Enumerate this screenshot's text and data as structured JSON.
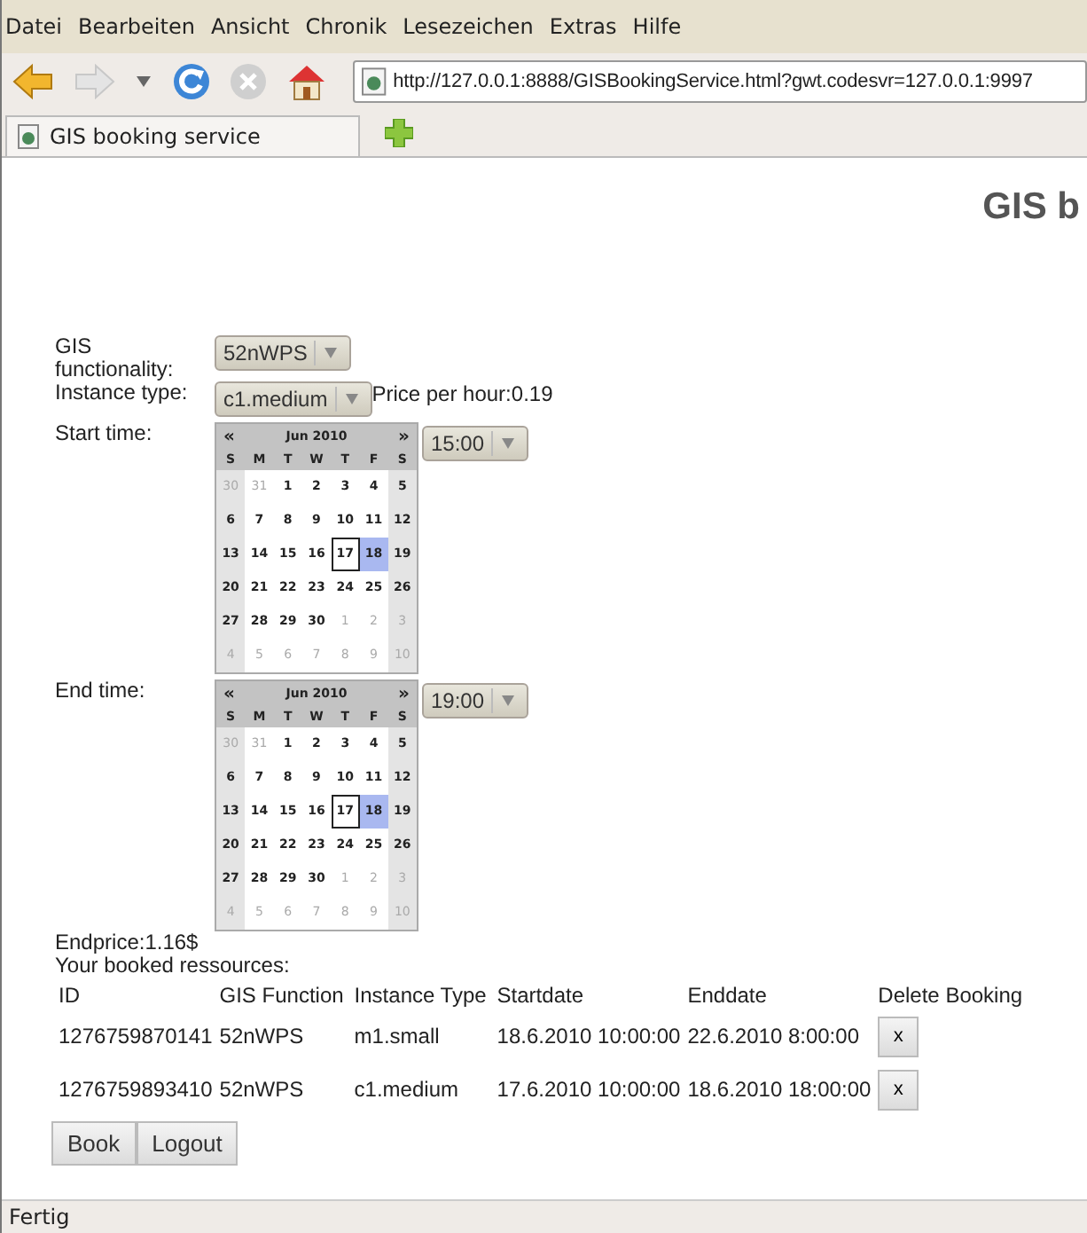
{
  "menu": [
    "Datei",
    "Bearbeiten",
    "Ansicht",
    "Chronik",
    "Lesezeichen",
    "Extras",
    "Hilfe"
  ],
  "address": {
    "value": "http://127.0.0.1:8888/GISBookingService.html?gwt.codesvr=127.0.0.1:9997"
  },
  "tab": {
    "title": "GIS booking service"
  },
  "heading": "GIS b",
  "form": {
    "gis_label": "GIS functionality:",
    "gis_value": "52nWPS",
    "instance_label": "Instance type:",
    "instance_value": "c1.medium",
    "price": "Price per hour:0.19",
    "pickers": [
      {
        "label": "Start time:",
        "time": "15:00",
        "calendar": {
          "prev": "«",
          "month": "Jun 2010",
          "next": "»",
          "weekdays": [
            "S",
            "M",
            "T",
            "W",
            "T",
            "F",
            "S"
          ],
          "weeks": [
            [
              {
                "d": "30",
                "other": true,
                "today": false,
                "selected": false
              },
              {
                "d": "31",
                "other": true,
                "today": false,
                "selected": false
              },
              {
                "d": "1",
                "other": false,
                "today": false,
                "selected": false
              },
              {
                "d": "2",
                "other": false,
                "today": false,
                "selected": false
              },
              {
                "d": "3",
                "other": false,
                "today": false,
                "selected": false
              },
              {
                "d": "4",
                "other": false,
                "today": false,
                "selected": false
              },
              {
                "d": "5",
                "other": false,
                "today": false,
                "selected": false
              }
            ],
            [
              {
                "d": "6",
                "other": false,
                "today": false,
                "selected": false
              },
              {
                "d": "7",
                "other": false,
                "today": false,
                "selected": false
              },
              {
                "d": "8",
                "other": false,
                "today": false,
                "selected": false
              },
              {
                "d": "9",
                "other": false,
                "today": false,
                "selected": false
              },
              {
                "d": "10",
                "other": false,
                "today": false,
                "selected": false
              },
              {
                "d": "11",
                "other": false,
                "today": false,
                "selected": false
              },
              {
                "d": "12",
                "other": false,
                "today": false,
                "selected": false
              }
            ],
            [
              {
                "d": "13",
                "other": false,
                "today": false,
                "selected": false
              },
              {
                "d": "14",
                "other": false,
                "today": false,
                "selected": false
              },
              {
                "d": "15",
                "other": false,
                "today": false,
                "selected": false
              },
              {
                "d": "16",
                "other": false,
                "today": false,
                "selected": false
              },
              {
                "d": "17",
                "other": false,
                "today": true,
                "selected": false
              },
              {
                "d": "18",
                "other": false,
                "today": false,
                "selected": true
              },
              {
                "d": "19",
                "other": false,
                "today": false,
                "selected": false
              }
            ],
            [
              {
                "d": "20",
                "other": false,
                "today": false,
                "selected": false
              },
              {
                "d": "21",
                "other": false,
                "today": false,
                "selected": false
              },
              {
                "d": "22",
                "other": false,
                "today": false,
                "selected": false
              },
              {
                "d": "23",
                "other": false,
                "today": false,
                "selected": false
              },
              {
                "d": "24",
                "other": false,
                "today": false,
                "selected": false
              },
              {
                "d": "25",
                "other": false,
                "today": false,
                "selected": false
              },
              {
                "d": "26",
                "other": false,
                "today": false,
                "selected": false
              }
            ],
            [
              {
                "d": "27",
                "other": false,
                "today": false,
                "selected": false
              },
              {
                "d": "28",
                "other": false,
                "today": false,
                "selected": false
              },
              {
                "d": "29",
                "other": false,
                "today": false,
                "selected": false
              },
              {
                "d": "30",
                "other": false,
                "today": false,
                "selected": false
              },
              {
                "d": "1",
                "other": true,
                "today": false,
                "selected": false
              },
              {
                "d": "2",
                "other": true,
                "today": false,
                "selected": false
              },
              {
                "d": "3",
                "other": true,
                "today": false,
                "selected": false
              }
            ],
            [
              {
                "d": "4",
                "other": true,
                "today": false,
                "selected": false
              },
              {
                "d": "5",
                "other": true,
                "today": false,
                "selected": false
              },
              {
                "d": "6",
                "other": true,
                "today": false,
                "selected": false
              },
              {
                "d": "7",
                "other": true,
                "today": false,
                "selected": false
              },
              {
                "d": "8",
                "other": true,
                "today": false,
                "selected": false
              },
              {
                "d": "9",
                "other": true,
                "today": false,
                "selected": false
              },
              {
                "d": "10",
                "other": true,
                "today": false,
                "selected": false
              }
            ]
          ]
        }
      },
      {
        "label": "End time:",
        "time": "19:00",
        "calendar": {
          "prev": "«",
          "month": "Jun 2010",
          "next": "»",
          "weekdays": [
            "S",
            "M",
            "T",
            "W",
            "T",
            "F",
            "S"
          ],
          "weeks": [
            [
              {
                "d": "30",
                "other": true,
                "today": false,
                "selected": false
              },
              {
                "d": "31",
                "other": true,
                "today": false,
                "selected": false
              },
              {
                "d": "1",
                "other": false,
                "today": false,
                "selected": false
              },
              {
                "d": "2",
                "other": false,
                "today": false,
                "selected": false
              },
              {
                "d": "3",
                "other": false,
                "today": false,
                "selected": false
              },
              {
                "d": "4",
                "other": false,
                "today": false,
                "selected": false
              },
              {
                "d": "5",
                "other": false,
                "today": false,
                "selected": false
              }
            ],
            [
              {
                "d": "6",
                "other": false,
                "today": false,
                "selected": false
              },
              {
                "d": "7",
                "other": false,
                "today": false,
                "selected": false
              },
              {
                "d": "8",
                "other": false,
                "today": false,
                "selected": false
              },
              {
                "d": "9",
                "other": false,
                "today": false,
                "selected": false
              },
              {
                "d": "10",
                "other": false,
                "today": false,
                "selected": false
              },
              {
                "d": "11",
                "other": false,
                "today": false,
                "selected": false
              },
              {
                "d": "12",
                "other": false,
                "today": false,
                "selected": false
              }
            ],
            [
              {
                "d": "13",
                "other": false,
                "today": false,
                "selected": false
              },
              {
                "d": "14",
                "other": false,
                "today": false,
                "selected": false
              },
              {
                "d": "15",
                "other": false,
                "today": false,
                "selected": false
              },
              {
                "d": "16",
                "other": false,
                "today": false,
                "selected": false
              },
              {
                "d": "17",
                "other": false,
                "today": true,
                "selected": false
              },
              {
                "d": "18",
                "other": false,
                "today": false,
                "selected": true
              },
              {
                "d": "19",
                "other": false,
                "today": false,
                "selected": false
              }
            ],
            [
              {
                "d": "20",
                "other": false,
                "today": false,
                "selected": false
              },
              {
                "d": "21",
                "other": false,
                "today": false,
                "selected": false
              },
              {
                "d": "22",
                "other": false,
                "today": false,
                "selected": false
              },
              {
                "d": "23",
                "other": false,
                "today": false,
                "selected": false
              },
              {
                "d": "24",
                "other": false,
                "today": false,
                "selected": false
              },
              {
                "d": "25",
                "other": false,
                "today": false,
                "selected": false
              },
              {
                "d": "26",
                "other": false,
                "today": false,
                "selected": false
              }
            ],
            [
              {
                "d": "27",
                "other": false,
                "today": false,
                "selected": false
              },
              {
                "d": "28",
                "other": false,
                "today": false,
                "selected": false
              },
              {
                "d": "29",
                "other": false,
                "today": false,
                "selected": false
              },
              {
                "d": "30",
                "other": false,
                "today": false,
                "selected": false
              },
              {
                "d": "1",
                "other": true,
                "today": false,
                "selected": false
              },
              {
                "d": "2",
                "other": true,
                "today": false,
                "selected": false
              },
              {
                "d": "3",
                "other": true,
                "today": false,
                "selected": false
              }
            ],
            [
              {
                "d": "4",
                "other": true,
                "today": false,
                "selected": false
              },
              {
                "d": "5",
                "other": true,
                "today": false,
                "selected": false
              },
              {
                "d": "6",
                "other": true,
                "today": false,
                "selected": false
              },
              {
                "d": "7",
                "other": true,
                "today": false,
                "selected": false
              },
              {
                "d": "8",
                "other": true,
                "today": false,
                "selected": false
              },
              {
                "d": "9",
                "other": true,
                "today": false,
                "selected": false
              },
              {
                "d": "10",
                "other": true,
                "today": false,
                "selected": false
              }
            ]
          ]
        }
      }
    ],
    "endprice": "Endprice:1.16$",
    "booked_label": "Your booked ressources:"
  },
  "table": {
    "columns": [
      "ID",
      "GIS Function",
      "Instance Type",
      "Startdate",
      "Enddate",
      "Delete Booking"
    ],
    "rows": [
      {
        "cells": [
          "1276759870141",
          "52nWPS",
          "m1.small",
          "18.6.2010 10:00:00",
          "22.6.2010 8:00:00"
        ],
        "delete": "x"
      },
      {
        "cells": [
          "1276759893410",
          "52nWPS",
          "c1.medium",
          "17.6.2010 10:00:00",
          "18.6.2010 18:00:00"
        ],
        "delete": "x"
      }
    ]
  },
  "buttons": [
    "Book",
    "Logout"
  ],
  "status_bar": "Fertig"
}
